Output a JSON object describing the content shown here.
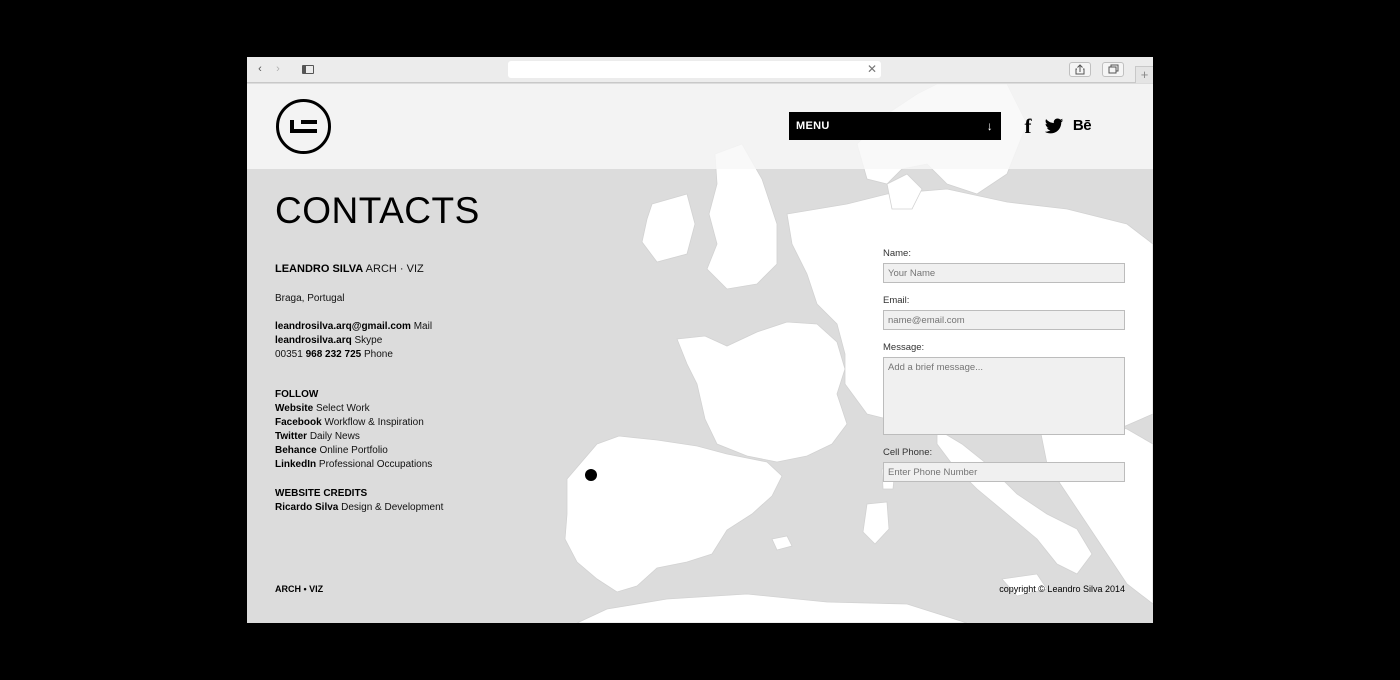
{
  "browser": {
    "back_icon": "‹",
    "forward_icon": "›",
    "url_clear_icon": "✕",
    "new_tab_icon": "+"
  },
  "header": {
    "logo_alt": "LS",
    "menu_label": "MENU",
    "menu_arrow": "↓",
    "facebook_icon": "f",
    "behance_icon": "Bē"
  },
  "page": {
    "title": "CONTACTS"
  },
  "identity": {
    "name": "LEANDRO SILVA",
    "tagline": "ARCH · VIZ",
    "location": "Braga, Portugal"
  },
  "contacts": [
    {
      "value": "leandrosilva.arq@gmail.com",
      "type": "Mail"
    },
    {
      "value": "leandrosilva.arq",
      "type": "Skype"
    }
  ],
  "phone": {
    "prefix": "00351",
    "number": "968 232 725",
    "type": "Phone"
  },
  "follow": {
    "heading": "FOLLOW",
    "items": [
      {
        "name": "Website",
        "desc": "Select Work"
      },
      {
        "name": "Facebook",
        "desc": "Workflow & Inspiration"
      },
      {
        "name": "Twitter",
        "desc": "Daily News"
      },
      {
        "name": "Behance",
        "desc": "Online Portfolio"
      },
      {
        "name": "LinkedIn",
        "desc": "Professional Occupations"
      }
    ]
  },
  "credits": {
    "heading": "WEBSITE CREDITS",
    "name": "Ricardo Silva",
    "role": "Design & Development"
  },
  "form": {
    "name_label": "Name:",
    "name_placeholder": "Your Name",
    "email_label": "Email:",
    "email_placeholder": "name@email.com",
    "message_label": "Message:",
    "message_placeholder": "Add a brief message...",
    "phone_label": "Cell Phone:",
    "phone_placeholder": "Enter Phone Number"
  },
  "footer": {
    "left": "ARCH • VIZ",
    "right": "copyright © Leandro Silva 2014"
  },
  "colors": {
    "background": "#dcdcdc",
    "land": "#ffffff",
    "accent": "#000000"
  },
  "icons": [
    "back-icon",
    "forward-icon",
    "sidebar-icon",
    "share-icon",
    "tabs-icon",
    "facebook-icon",
    "twitter-icon",
    "behance-icon",
    "location-marker-icon"
  ]
}
